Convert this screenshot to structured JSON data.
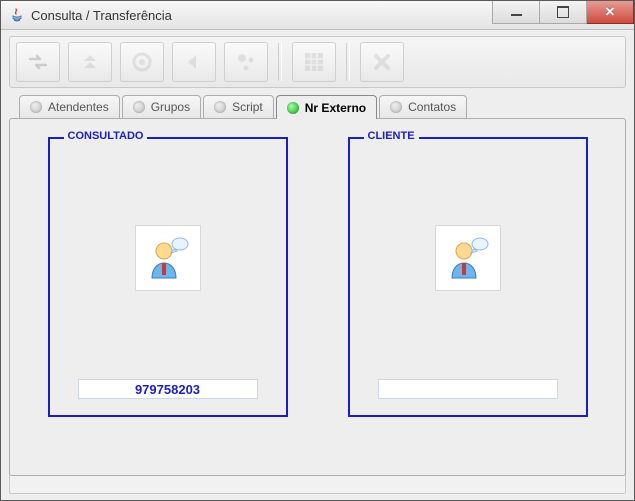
{
  "window": {
    "title": "Consulta / Transferência"
  },
  "toolbar": {
    "icons": [
      "swap",
      "up",
      "target",
      "back",
      "nodes",
      "grid",
      "cancel"
    ]
  },
  "tabs": {
    "items": [
      {
        "label": "Atendentes",
        "active": false
      },
      {
        "label": "Grupos",
        "active": false
      },
      {
        "label": "Script",
        "active": false
      },
      {
        "label": "Nr Externo",
        "active": true
      },
      {
        "label": "Contatos",
        "active": false
      }
    ]
  },
  "panel": {
    "consultado": {
      "legend": "CONSULTADO",
      "value": "979758203"
    },
    "cliente": {
      "legend": "CLIENTE",
      "value": ""
    }
  },
  "statusbar": {
    "text": ""
  }
}
